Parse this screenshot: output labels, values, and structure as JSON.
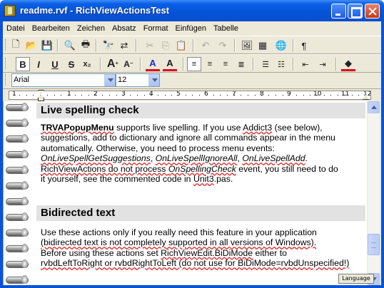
{
  "window": {
    "title": "readme.rvf - RichViewActionsTest"
  },
  "menu": [
    "Datei",
    "Bearbeiten",
    "Zeichen",
    "Absatz",
    "Format",
    "Einfügen",
    "Tabelle"
  ],
  "toolbar1": [
    {
      "name": "new-document-icon",
      "glyph": "🗋"
    },
    {
      "name": "open-folder-icon",
      "glyph": "📂"
    },
    {
      "name": "save-icon",
      "glyph": "💾"
    },
    {
      "name": "print-preview-icon",
      "glyph": "🔍"
    },
    {
      "name": "print-icon",
      "glyph": "🖶"
    },
    {
      "name": "find-icon",
      "glyph": "🔭"
    },
    {
      "name": "replace-icon",
      "glyph": "⇄"
    },
    {
      "name": "cut-icon",
      "glyph": "✂"
    },
    {
      "name": "copy-icon",
      "glyph": "⎘"
    },
    {
      "name": "paste-icon",
      "glyph": "📋"
    },
    {
      "name": "undo-icon",
      "glyph": "↶"
    },
    {
      "name": "redo-icon",
      "glyph": "↷"
    },
    {
      "name": "insert-picture-icon",
      "glyph": "🖼"
    },
    {
      "name": "insert-table-icon",
      "glyph": "▦"
    },
    {
      "name": "insert-hyperlink-icon",
      "glyph": "🌐"
    },
    {
      "name": "show-special-chars-icon",
      "glyph": "¶"
    }
  ],
  "toolbar2": [
    {
      "name": "bold-icon",
      "glyph": "B"
    },
    {
      "name": "italic-icon",
      "glyph": "I"
    },
    {
      "name": "underline-icon",
      "glyph": "U"
    },
    {
      "name": "strikeout-icon",
      "glyph": "S"
    },
    {
      "name": "text-color-icon",
      "glyph": "A"
    },
    {
      "name": "highlight-icon",
      "glyph": "A"
    }
  ],
  "font": {
    "name": "Arial",
    "size": "12"
  },
  "ruler": {
    "numbers": [
      "1",
      "1",
      "2",
      "3",
      "4",
      "5",
      "6",
      "7",
      "8",
      "9",
      "10",
      "11",
      "12"
    ]
  },
  "doc": {
    "heading1": "Live spelling check",
    "para1": {
      "l1_bold": "TRVAPopupMenu",
      "l1_a": " supports live spelling. If you use ",
      "l1_link": "Addict3",
      "l1_b": " (see below),",
      "l2": "suggestions, add to dictionary and ignore all commands appear in the menu",
      "l3": "automatically. Otherwise, you need to process menu events:",
      "l4_e1": "OnLiveSpellGetSuggestions",
      "l4_sep1": ", ",
      "l4_e2": "OnLiveSpellIgnoreAll",
      "l4_sep2": ", ",
      "l4_e3": "OnLiveSpellAdd",
      "l4_end": ".",
      "l5_a": "RichViewActions do not process ",
      "l5_e": "OnSpellingCheck",
      "l5_b": " event, you still need to do",
      "l6_a": "it yourself, see the commented code in ",
      "l6_link": "Unit3",
      "l6_b": ".pas."
    },
    "heading2": "Bidirected text",
    "para2": {
      "l1": "Use these actions only if you really need this feature in your application",
      "l2": "(bidirected text is not completely supported in all versions of Windows).",
      "l3_a": "Before using these actions set ",
      "l3_code": "RichViewEdit.BiDiMode",
      "l3_b": " either to",
      "l4": "rvbdLeftToRight or rvbdRightToLeft (do not use for BiDiMode=rvbdUnspecified!)"
    }
  },
  "language_button": "Language"
}
